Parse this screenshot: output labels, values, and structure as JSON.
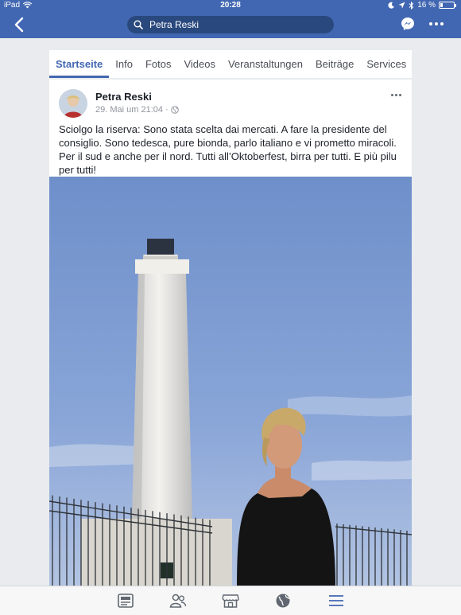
{
  "status_bar": {
    "device": "iPad",
    "time": "20:28",
    "battery": "16 %",
    "battery_level": 0.16
  },
  "navbar": {
    "search_text": "Petra Reski",
    "icons": [
      "back-chevron-icon",
      "search-icon",
      "messenger-icon",
      "more-icon"
    ]
  },
  "page_tabs": [
    {
      "label": "Startseite",
      "active": true
    },
    {
      "label": "Info",
      "active": false
    },
    {
      "label": "Fotos",
      "active": false
    },
    {
      "label": "Videos",
      "active": false
    },
    {
      "label": "Veranstaltungen",
      "active": false
    },
    {
      "label": "Beiträge",
      "active": false
    },
    {
      "label": "Services",
      "active": false
    }
  ],
  "post": {
    "author": "Petra Reski",
    "timestamp": "29. Mai um 21:04 ·",
    "privacy_icon": "globe-icon",
    "text": "Sciolgo la riserva: Sono stata scelta dai mercati. A fare la presidente del consiglio. Sono tedesca, pure bionda, parlo italiano e vi prometto miracoli. Per il sud e anche per il nord. Tutti all’Oktoberfest, birra per tutti. E più pilu per tutti!"
  },
  "bottom_tabbar": [
    "news-feed-icon",
    "friends-icon",
    "marketplace-icon",
    "globe-icon",
    "menu-icon"
  ],
  "colors": {
    "brand_blue": "#4267b2",
    "sky": "#6f8fc8"
  }
}
